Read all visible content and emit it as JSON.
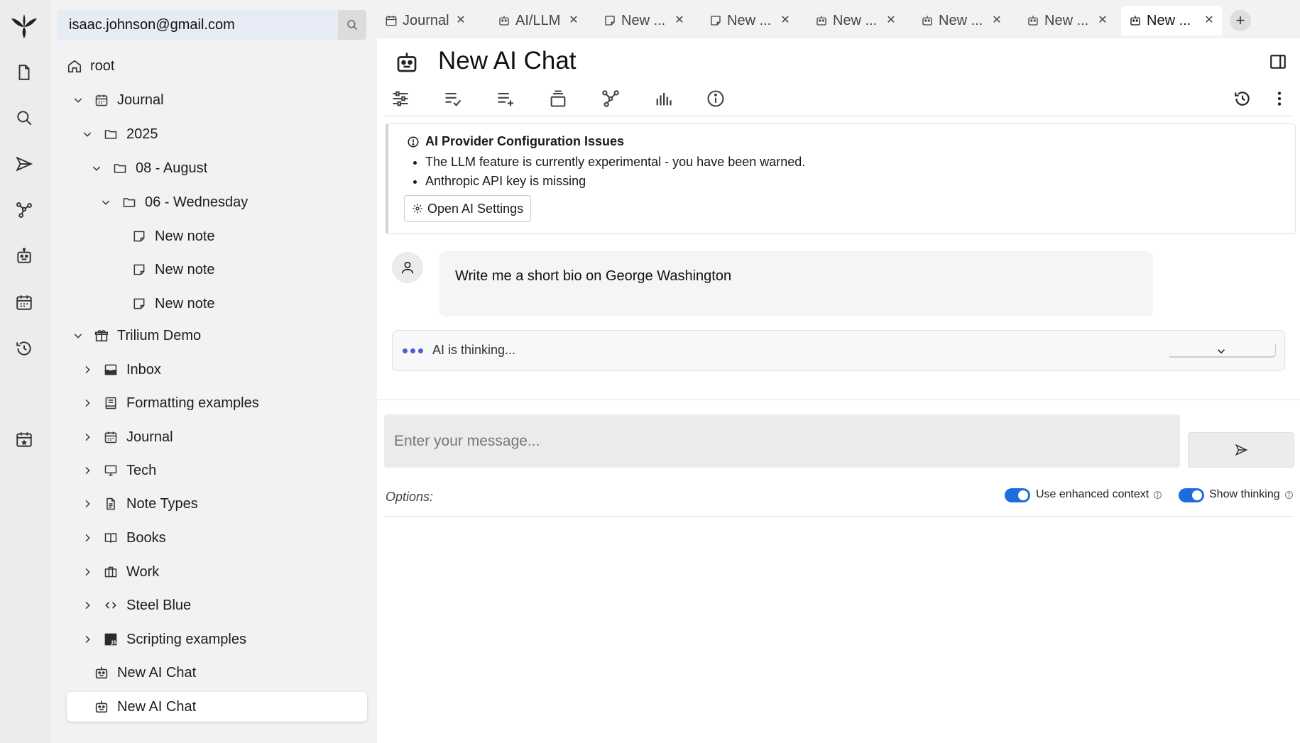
{
  "search": {
    "value": "isaac.johnson@gmail.com"
  },
  "launcher": {
    "items": [
      "new-note",
      "search",
      "jump-to",
      "note-map",
      "ai-chat",
      "calendar",
      "recent-changes",
      "today"
    ]
  },
  "tree": {
    "root_label": "root",
    "items": [
      "Journal",
      "2025",
      "08 - August",
      "06 - Wednesday",
      "New note",
      "New note",
      "New note",
      "Trilium Demo",
      "Inbox",
      "Formatting examples",
      "Journal",
      "Tech",
      "Note Types",
      "Books",
      "Work",
      "Steel Blue",
      "Scripting examples",
      "New AI Chat",
      "New AI Chat"
    ]
  },
  "tabs": [
    {
      "label": "Journal"
    },
    {
      "label": "AI/LLM"
    },
    {
      "label": "New ..."
    },
    {
      "label": "New ..."
    },
    {
      "label": "New ..."
    },
    {
      "label": "New ..."
    },
    {
      "label": "New ..."
    },
    {
      "label": "New ..."
    }
  ],
  "note": {
    "title": "New AI Chat"
  },
  "alert": {
    "title": "AI Provider Configuration Issues",
    "items": [
      "The LLM feature is currently experimental - you have been warned.",
      "Anthropic API key is missing"
    ],
    "button": "Open AI Settings"
  },
  "chat": {
    "user_message": "Write me a short bio on George Washington",
    "thinking": "AI is thinking...",
    "input_placeholder": "Enter your message..."
  },
  "options": {
    "label": "Options:",
    "enhanced_context": "Use enhanced context",
    "show_thinking": "Show thinking"
  },
  "colors": {
    "accent": "#1a6ddb",
    "thinking_dots": "#4a60d8"
  }
}
